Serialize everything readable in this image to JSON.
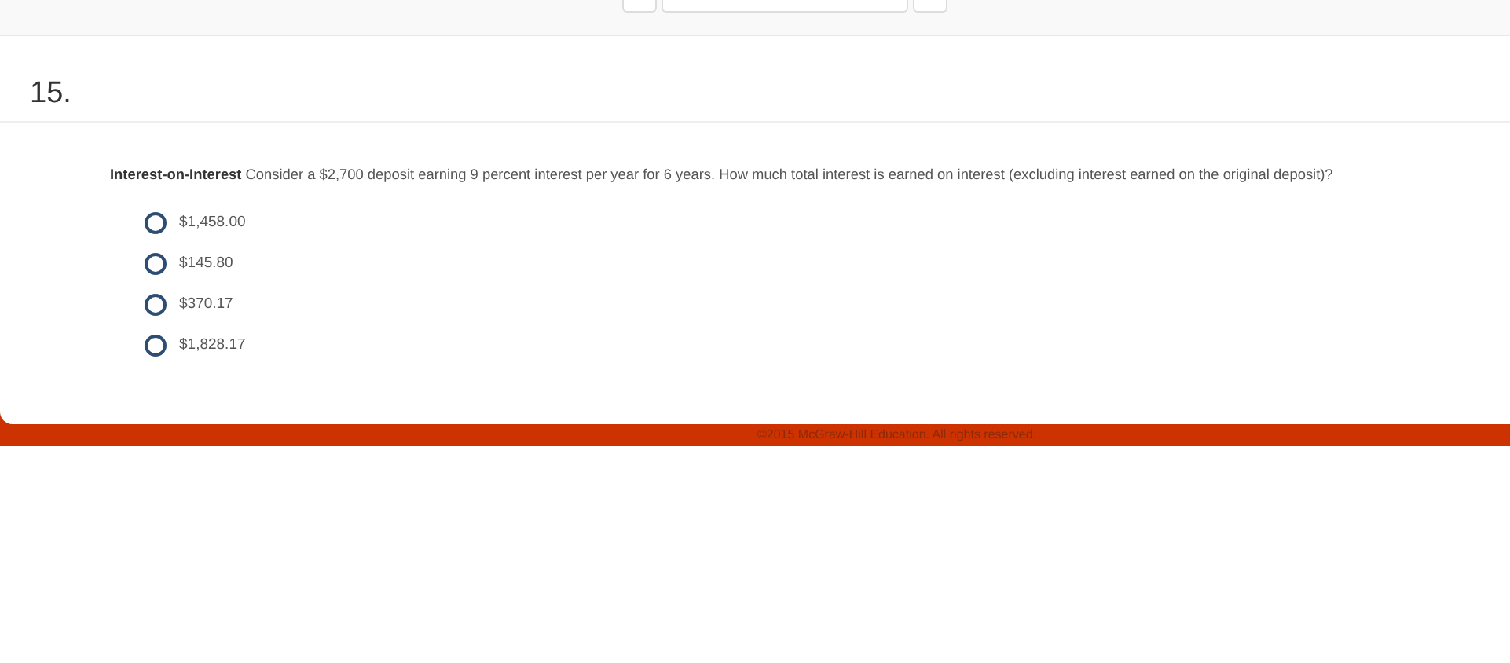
{
  "question": {
    "number": "15.",
    "title": "Interest-on-Interest",
    "text": "Consider a $2,700 deposit earning 9 percent interest per year for 6 years. How much total interest is earned on interest (excluding interest earned on the original deposit)?"
  },
  "options": [
    {
      "label": "$1,458.00",
      "selected": false
    },
    {
      "label": "$145.80",
      "selected": false
    },
    {
      "label": "$370.17",
      "selected": false
    },
    {
      "label": "$1,828.17",
      "selected": false
    }
  ],
  "footer": {
    "copyright": "©2015 McGraw-Hill Education. All rights reserved."
  }
}
